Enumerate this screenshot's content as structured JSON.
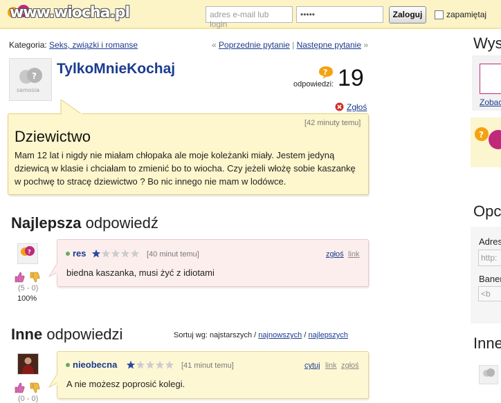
{
  "header": {
    "logo_text": "www.wiocha.pl",
    "email_placeholder": "adres e-mail lub login",
    "password_value": "•••••",
    "login_button": "Zaloguj",
    "remember_label": "zapamiętaj"
  },
  "nav": {
    "category_label": "Kategoria:",
    "category_link": "Seks, związki i romanse",
    "prev_prefix": "«",
    "prev_link": "Poprzednie pytanie",
    "separator": "|",
    "next_link": "Następne pytanie",
    "next_suffix": "»"
  },
  "question": {
    "username": "TylkoMnieKochaj",
    "answers_label": "odpowiedzi:",
    "answers_count": "19",
    "report_link": "Zgłoś",
    "time": "[42 minuty temu]",
    "title": "Dziewictwo",
    "body": "Mam 12 lat i nigdy nie miałam chłopaka ale moje koleżanki miały. Jestem jedyną dziewicą w klasie i chciałam to zmienić bo to wiocha. Czy jeżeli włożę sobie kaszankę w pochwę to stracę dziewictwo ? Bo nic innego nie mam w lodówce."
  },
  "best_answer": {
    "heading_bold": "Najlepsza",
    "heading_rest": "odpowiedź",
    "author": "res",
    "rating_stars": 1,
    "time": "[40 minut temu]",
    "report_link": "zgłoś",
    "link_label": "link",
    "text": "biedna kaszanka, musi żyć z idiotami",
    "votes": "(5 - 0)",
    "percent": "100%"
  },
  "other_answers": {
    "heading_bold": "Inne",
    "heading_rest": "odpowiedzi",
    "sort_label": "Sortuj wg: najstarszych /",
    "sort_newest": "najnowszych",
    "sort_sep": "/",
    "sort_best": "najlepszych",
    "items": [
      {
        "author": "nieobecna",
        "rating_stars": 1,
        "time": "[41 minut temu]",
        "quote_link": "cytuj",
        "link_label": "link",
        "report_link": "zgłoś",
        "text": "A nie możesz poprosić kolegi.",
        "votes": "(0 - 0)"
      }
    ]
  },
  "sidebar": {
    "title1": "Wys",
    "link1": "Zobac",
    "title2": "Opc",
    "label_address": "Adres",
    "address_placeholder": "http:",
    "label_banner": "Baner",
    "banner_placeholder": "<b",
    "title3": "Inne"
  },
  "colors": {
    "topbar_bg": "#fcf3c7",
    "link": "#1a3b8f",
    "question_box": "#fef6cc",
    "best_answer_box": "#fdeeee",
    "answer_box": "#fef7d4",
    "star_filled": "#2a4aa0",
    "star_empty": "#cccccc",
    "bubble_orange": "#f4a20f",
    "bubble_magenta": "#c0287a"
  }
}
